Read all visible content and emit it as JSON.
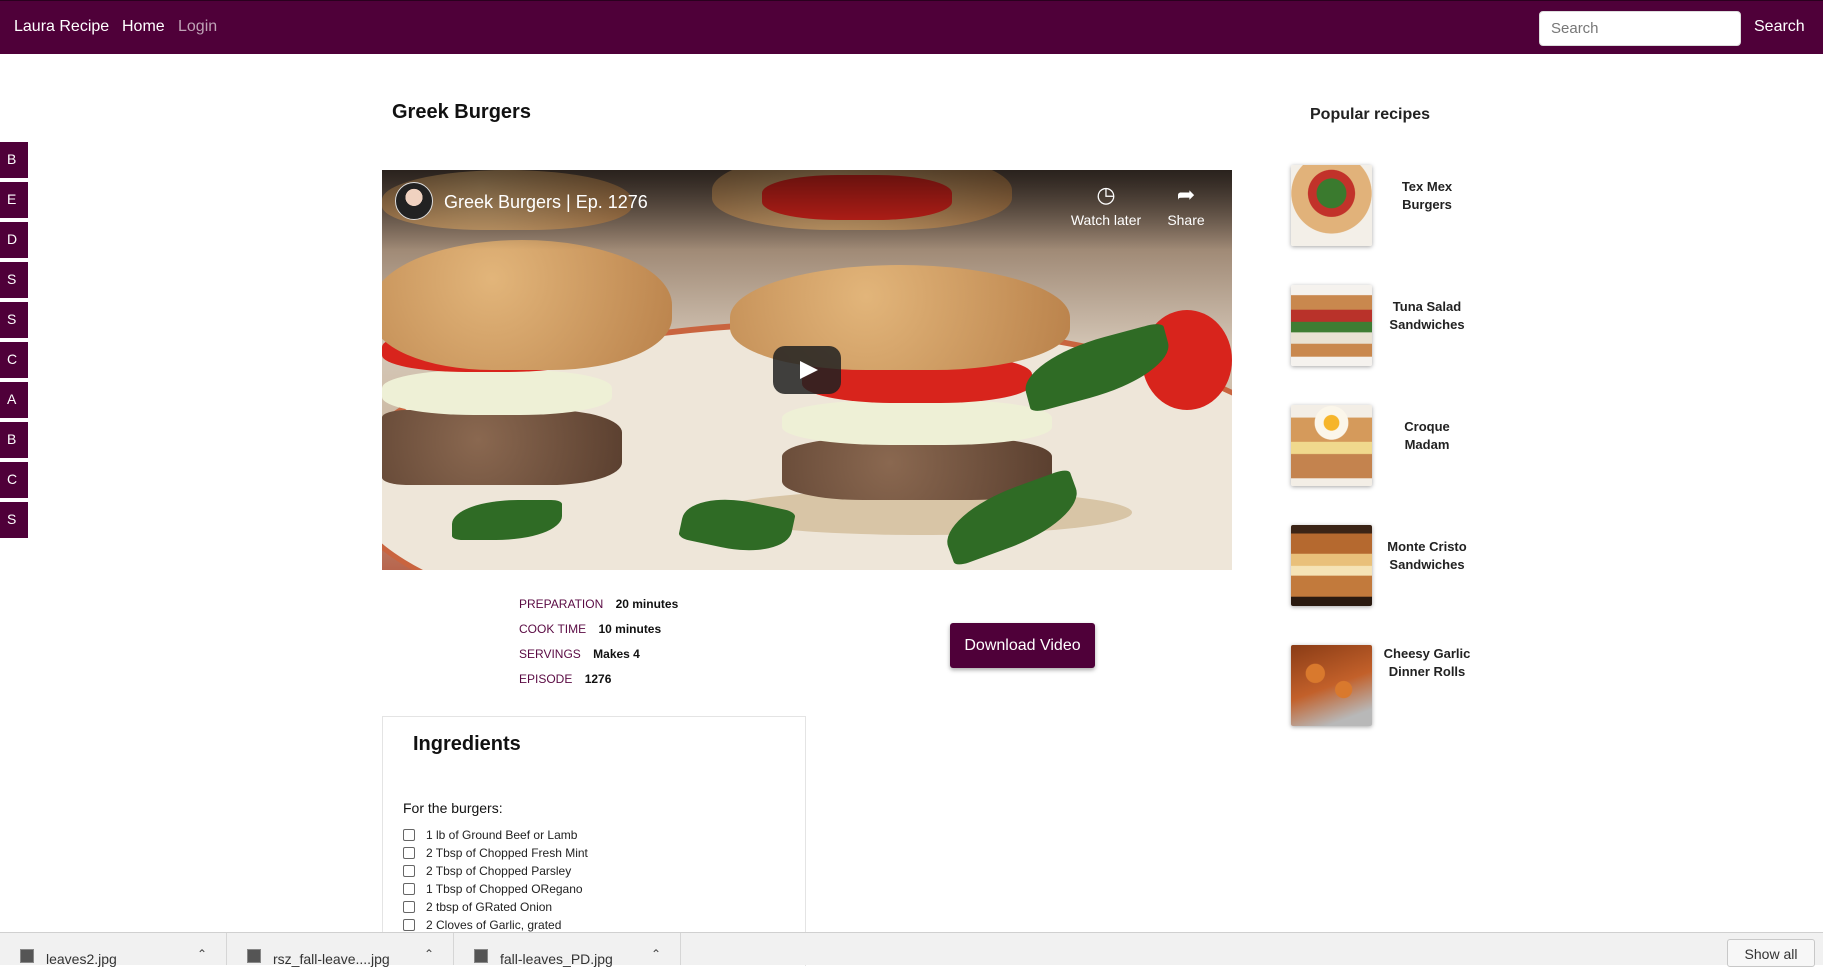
{
  "navbar": {
    "brand": "Laura Recipe",
    "home": "Home",
    "login": "Login",
    "search_placeholder": "Search",
    "search_button": "Search"
  },
  "letters": [
    "B",
    "E",
    "D",
    "S",
    "S",
    "C",
    "A",
    "B",
    "C",
    "S"
  ],
  "recipe": {
    "title": "Greek Burgers"
  },
  "video": {
    "title": "Greek Burgers | Ep. 1276",
    "watch_later": "Watch later",
    "share": "Share"
  },
  "meta": [
    {
      "label": "PREPARATION",
      "value": "20 minutes"
    },
    {
      "label": "COOK TIME",
      "value": "10 minutes"
    },
    {
      "label": "SERVINGS",
      "value": "Makes 4"
    },
    {
      "label": "EPISODE",
      "value": "1276"
    }
  ],
  "download_button": "Download Video",
  "ingredients": {
    "title": "Ingredients",
    "subtitle": "For the burgers:",
    "items": [
      "1 lb of Ground Beef or Lamb",
      "2 Tbsp of Chopped Fresh Mint",
      "2 Tbsp of Chopped Parsley",
      "1 Tbsp of Chopped ORegano",
      "2 tbsp of GRated Onion",
      "2 Cloves of Garlic, grated"
    ]
  },
  "popular": {
    "title": "Popular recipes",
    "items": [
      {
        "label": "Tex Mex Burgers"
      },
      {
        "label": "Tuna Salad Sandwiches"
      },
      {
        "label": "Croque Madam"
      },
      {
        "label": "Monte Cristo Sandwiches"
      },
      {
        "label": "Cheesy Garlic Dinner Rolls"
      }
    ]
  },
  "downloads": {
    "files": [
      "leaves2.jpg",
      "rsz_fall-leave....jpg",
      "fall-leaves_PD.jpg"
    ],
    "show_all": "Show all"
  },
  "colors": {
    "brand": "#4f0039",
    "meta_label": "#5a0a43"
  }
}
